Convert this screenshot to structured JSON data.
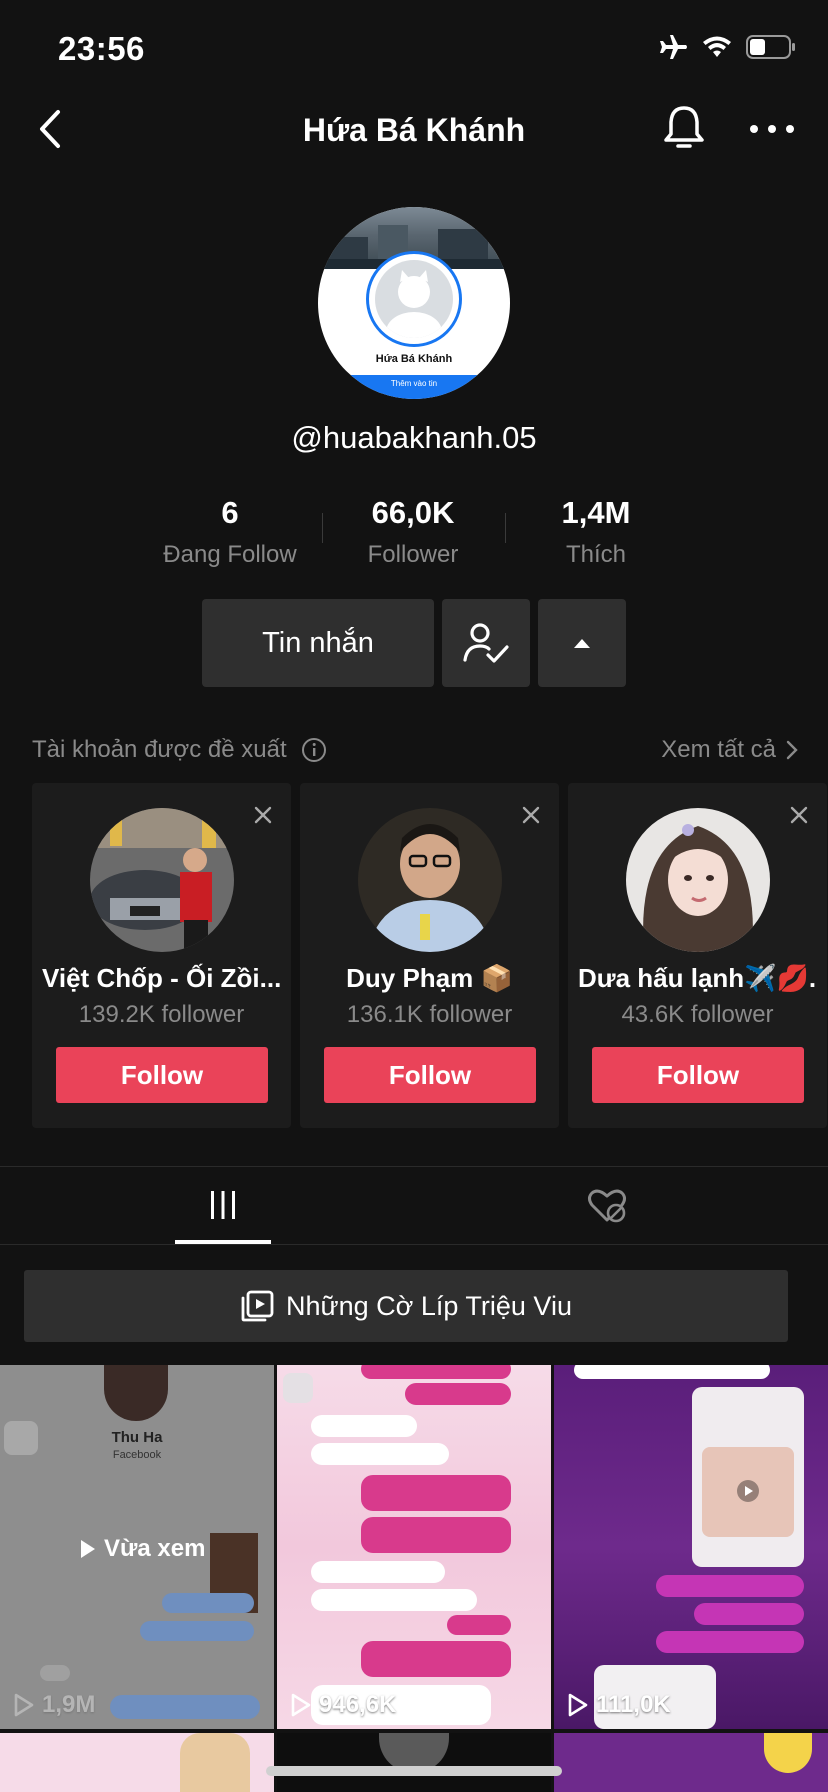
{
  "status": {
    "time": "23:56"
  },
  "nav": {
    "title": "Hứa Bá Khánh"
  },
  "profile": {
    "avatar_name": "Hứa Bá Khánh",
    "avatar_button": "Thêm vào tin",
    "handle": "@huabakhanh.05"
  },
  "stats": [
    {
      "value": "6",
      "label": "Đang Follow"
    },
    {
      "value": "66,0K",
      "label": "Follower"
    },
    {
      "value": "1,4M",
      "label": "Thích"
    }
  ],
  "actions": {
    "message_label": "Tin nhắn"
  },
  "suggested": {
    "heading": "Tài khoản được đề xuất",
    "see_all": "Xem tất cả",
    "cards": [
      {
        "name": "Việt Chốp - Ối Zồi...",
        "followers": "139.2K follower",
        "follow_label": "Follow"
      },
      {
        "name": "Duy Phạm 📦",
        "followers": "136.1K follower",
        "follow_label": "Follow"
      },
      {
        "name": "Dưa hấu lạnh✈️💋...",
        "followers": "43.6K follower",
        "follow_label": "Follow"
      }
    ]
  },
  "playlist": {
    "label": "Những Cờ Líp Triệu Viu"
  },
  "videos": [
    {
      "count": "1,9M",
      "overlay": "Vừa xem",
      "contact": "Thu Ha",
      "contact_sub": "Facebook"
    },
    {
      "count": "946,6K"
    },
    {
      "count": "111,0K"
    }
  ],
  "colors": {
    "background": "#121212",
    "follow_button": "#ea4359",
    "button_bg": "#2f2f2f",
    "muted_text": "#8a8a8a"
  }
}
